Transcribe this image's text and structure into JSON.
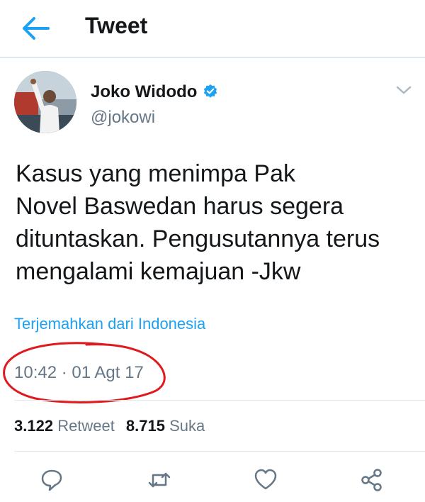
{
  "header": {
    "title": "Tweet",
    "back_icon": "arrow-left-icon"
  },
  "tweet": {
    "author_name": "Joko Widodo",
    "handle": "@jokowi",
    "text": "Kasus yang menimpa Pak\nNovel Baswedan harus segera\ndituntaskan. Pengusutannya terus\nmengalami kemajuan -Jkw",
    "translate_label": "Terjemahkan dari Indonesia",
    "timestamp": "10:42 · 01 Agt 17"
  },
  "stats": {
    "retweets_count": "3.122",
    "retweets_label": "Retweet",
    "likes_count": "8.715",
    "likes_label": "Suka"
  },
  "actions": [
    "reply-icon",
    "retweet-icon",
    "like-icon",
    "share-icon"
  ],
  "colors": {
    "accent": "#1da1f2",
    "secondary_text": "#657786",
    "annotation": "#e0191f"
  }
}
